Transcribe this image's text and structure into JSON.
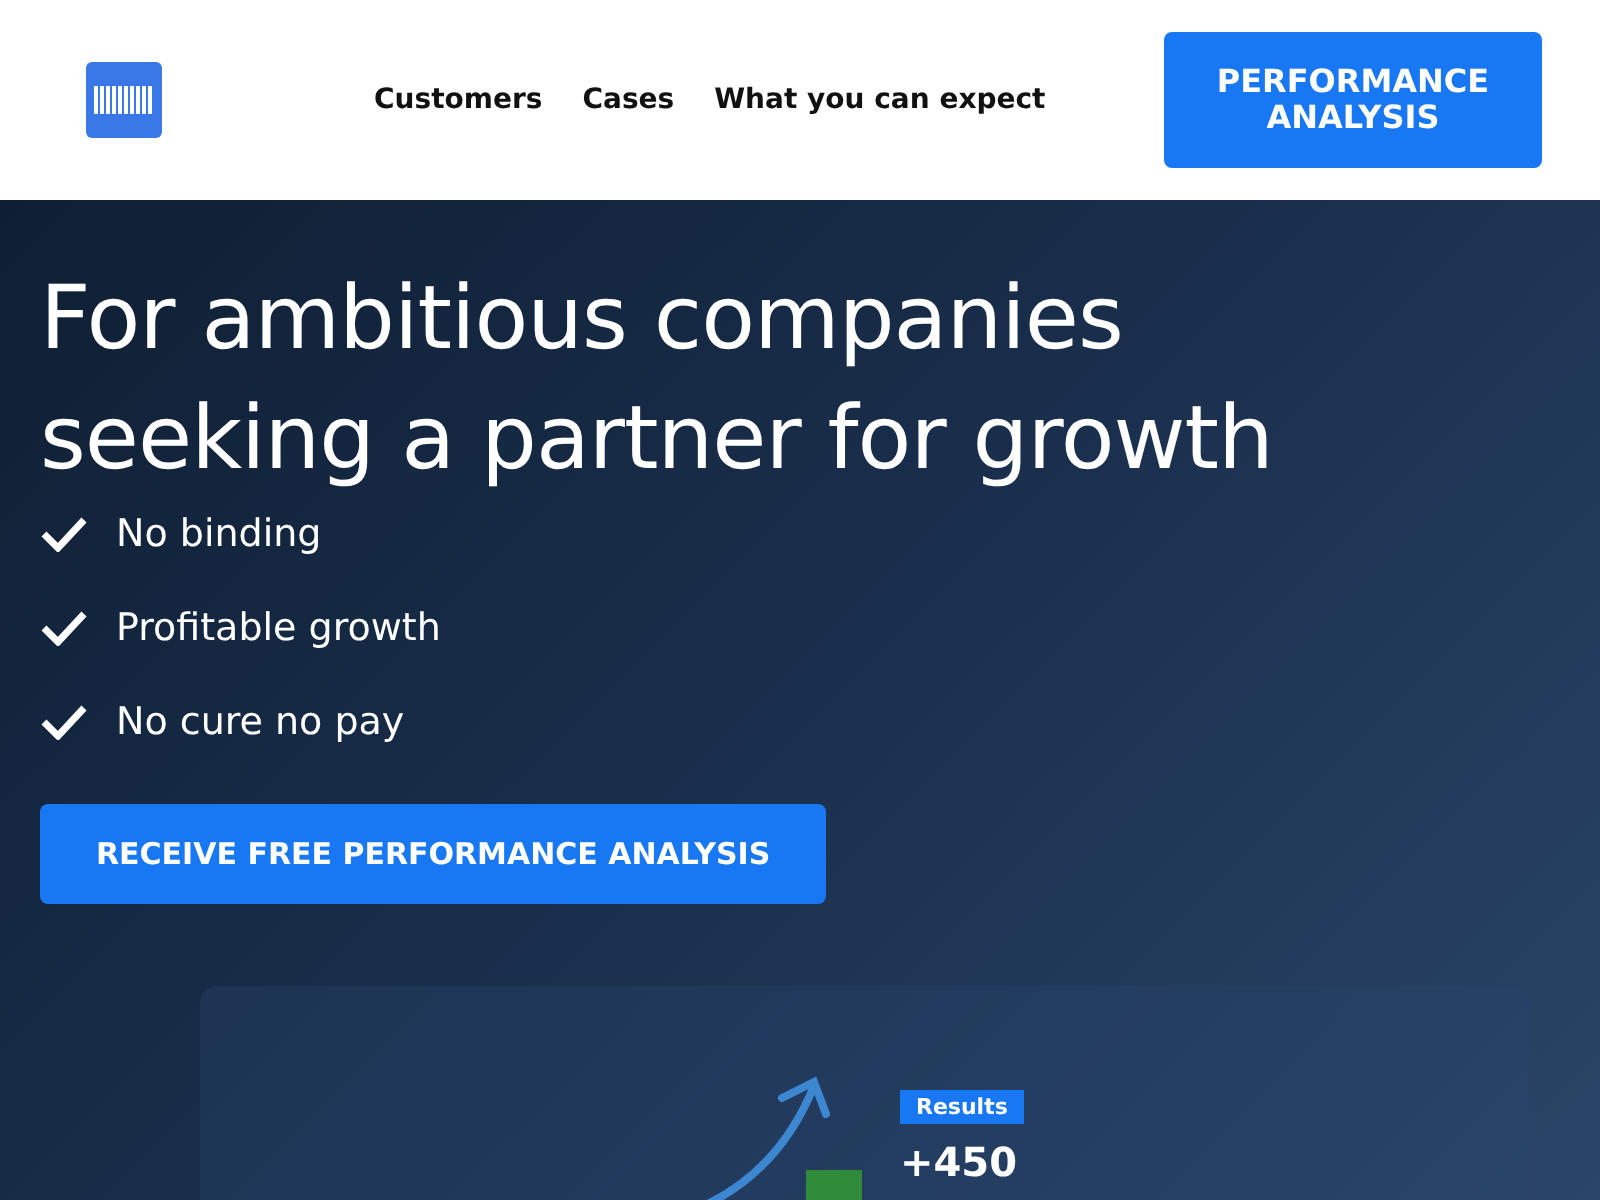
{
  "nav": {
    "links": [
      {
        "label": "Customers"
      },
      {
        "label": "Cases"
      },
      {
        "label": "What you can expect"
      }
    ],
    "cta": "PERFORMANCE ANALYSIS"
  },
  "hero": {
    "headline": "For ambitious companies seeking a partner for growth",
    "benefits": [
      {
        "label": "No binding"
      },
      {
        "label": "Profitable growth"
      },
      {
        "label": "No cure no pay"
      }
    ],
    "cta": "RECEIVE FREE PERFORMANCE ANALYSIS"
  },
  "preview": {
    "badge": "Results",
    "value": "+450"
  }
}
